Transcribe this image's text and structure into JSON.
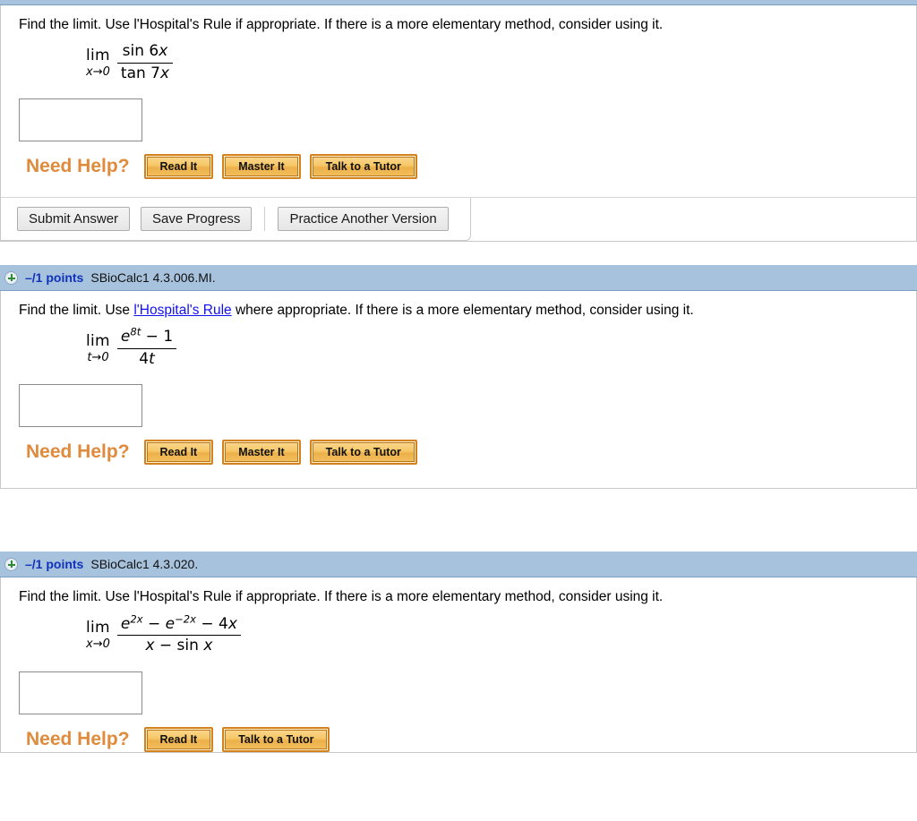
{
  "questions": [
    {
      "id": "q1",
      "header_visible": false,
      "points": "",
      "code": "",
      "prompt_pre": "Find the limit. Use l'Hospital's Rule if appropriate. If there is a more elementary method, consider using it.",
      "prompt_link": "",
      "prompt_post": "",
      "math": {
        "lim_label": "lim",
        "lim_sub": "x→0",
        "numerator": "sin 6x",
        "denominator": "tan 7x"
      },
      "answer_value": "",
      "need_help_label": "Need Help?",
      "help_buttons": [
        "Read It",
        "Master It",
        "Talk to a Tutor"
      ],
      "submit_buttons": [
        "Submit Answer",
        "Save Progress"
      ],
      "practice_button": "Practice Another Version",
      "has_submit_bar": true
    },
    {
      "id": "q2",
      "header_visible": true,
      "points": "–/1 points",
      "code": "SBioCalc1 4.3.006.MI.",
      "prompt_pre": "Find the limit. Use ",
      "prompt_link": "l'Hospital's Rule",
      "prompt_post": " where appropriate. If there is a more elementary method, consider using it.",
      "math": {
        "lim_label": "lim",
        "lim_sub": "t→0",
        "numerator": "e8t − 1",
        "denominator": "4t"
      },
      "answer_value": "",
      "need_help_label": "Need Help?",
      "help_buttons": [
        "Read It",
        "Master It",
        "Talk to a Tutor"
      ],
      "submit_buttons": [],
      "practice_button": "",
      "has_submit_bar": false
    },
    {
      "id": "q3",
      "header_visible": true,
      "points": "–/1 points",
      "code": "SBioCalc1 4.3.020.",
      "prompt_pre": "Find the limit. Use l'Hospital's Rule if appropriate. If there is a more elementary method, consider using it.",
      "prompt_link": "",
      "prompt_post": "",
      "math": {
        "lim_label": "lim",
        "lim_sub": "x→0",
        "numerator": "e2x − e−2x − 4x",
        "denominator": "x − sin x"
      },
      "answer_value": "",
      "need_help_label": "Need Help?",
      "help_buttons": [
        "Read It",
        "Talk to a Tutor"
      ],
      "submit_buttons": [],
      "practice_button": "",
      "has_submit_bar": false
    }
  ],
  "colors": {
    "header_bar": "#a6c2dc",
    "points_text": "#1133bb",
    "link": "#1111ee",
    "need_help": "#e08a3c",
    "help_button": "#f3c160",
    "expand_plus": "#2e8b33"
  },
  "icons": {
    "expand": "plus-circle-icon"
  }
}
